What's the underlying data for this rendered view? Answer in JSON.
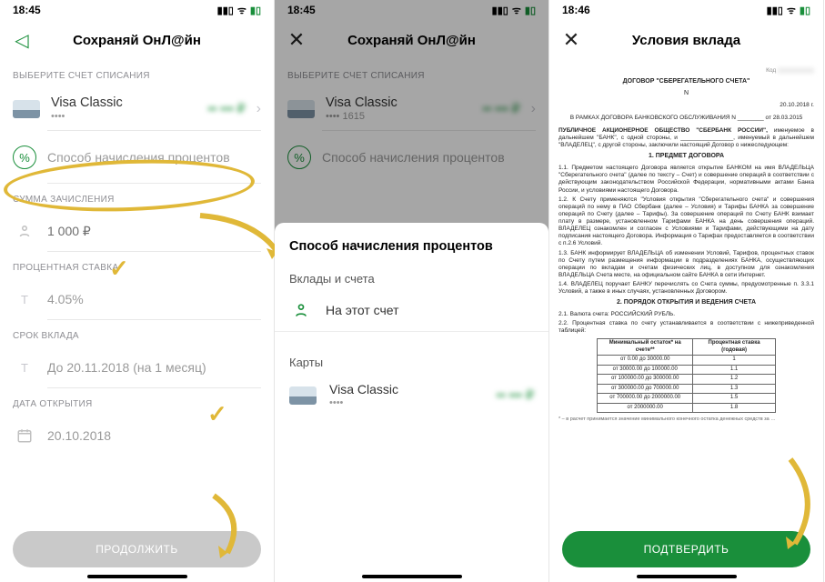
{
  "panel1": {
    "time": "18:45",
    "title": "Сохраняй ОнЛ@йн",
    "accountLabel": "ВЫБЕРИТЕ СЧЕТ СПИСАНИЯ",
    "card": {
      "name": "Visa Classic",
      "mask": "••••",
      "balance": "•• ••• ₽"
    },
    "interestMethod": "Способ начисления процентов",
    "amountLabel": "СУММА ЗАЧИСЛЕНИЯ",
    "amount": "1 000 ₽",
    "rateLabel": "ПРОЦЕНТНАЯ СТАВКА",
    "rate": "4.05%",
    "termLabel": "СРОК ВКЛАДА",
    "term": "До 20.11.2018 (на 1 месяц)",
    "openLabel": "ДАТА ОТКРЫТИЯ",
    "openDate": "20.10.2018",
    "button": "ПРОДОЛЖИТЬ"
  },
  "panel2": {
    "time": "18:45",
    "title": "Сохраняй ОнЛ@йн",
    "accountLabel": "ВЫБЕРИТЕ СЧЕТ СПИСАНИЯ",
    "card": {
      "name": "Visa Classic",
      "mask": "•••• 1615",
      "balance": "•• ••• ₽"
    },
    "interestMethod": "Способ начисления процентов",
    "sheetTitle": "Способ начисления процентов",
    "group1": "Вклады и счета",
    "opt1": "На этот счет",
    "group2": "Карты",
    "optCard": {
      "name": "Visa Classic",
      "mask": "••••",
      "balance": "•• ••• ₽"
    }
  },
  "panel3": {
    "time": "18:46",
    "title": "Условия вклада",
    "button": "ПОДТВЕРДИТЬ",
    "doc": {
      "kod": "Код",
      "head": "ДОГОВОР \"СБЕРЕГАТЕЛЬНОГО СЧЕТА\"",
      "n": "N",
      "date": "20.10.2018 г.",
      "frame": "В РАМКАХ ДОГОВОРА БАНКОВСКОГО ОБСЛУЖИВАНИЯ N ________ от 28.03.2015",
      "intro1": "ПУБЛИЧНОЕ АКЦИОНЕРНОЕ ОБЩЕСТВО \"СБЕРБАНК РОССИИ\",",
      "intro2": "именуемое в дальнейшем \"БАНК\", с одной стороны, и ________________, именуемый в дальнейшем \"ВЛАДЕЛЕЦ\", с другой стороны, заключили настоящий Договор о нижеследующем:",
      "s1": "1. ПРЕДМЕТ ДОГОВОРА",
      "p11": "1.1. Предметом настоящего Договора является открытие БАНКОМ на имя ВЛАДЕЛЬЦА \"Сберегательного счета\" (далее по тексту – Счет) и совершение операций в соответствии с действующим законодательством Российской Федерации, нормативными актами Банка России, и условиями настоящего Договора.",
      "p12": "1.2. К Счету применяются \"Условия открытия \"Сберегательного счета\" и совершения операций по нему в ПАО Сбербанк (далее – Условия) и Тарифы БАНКА за совершение операций по Счету (далее – Тарифы). За совершение операций по Счету БАНК взимает плату в размере, установленном Тарифами БАНКА на день совершения операций. ВЛАДЕЛЕЦ ознакомлен и согласен с Условиями и Тарифами, действующими на дату подписания настоящего Договора. Информация о Тарифах предоставляется в соответствии с п.2.6 Условий.",
      "p13": "1.3. БАНК информирует ВЛАДЕЛЬЦА об изменении Условий, Тарифов, процентных ставок по Счету путем размещения информации в подразделениях БАНКА, осуществляющих операции по вкладам и счетам физических лиц, в доступном для ознакомления ВЛАДЕЛЬЦА Счета месте, на официальном сайте БАНКА в сети Интернет.",
      "p14": "1.4. ВЛАДЕЛЕЦ поручает БАНКУ перечислять со Счета суммы, предусмотренные п. 3.3.1 Условий, а также в иных случаях, установленных Договором.",
      "s2": "2. ПОРЯДОК ОТКРЫТИЯ И ВЕДЕНИЯ СЧЕТА",
      "p21": "2.1. Валюта счета: РОССИЙСКИЙ РУБЛЬ.",
      "p22": "2.2. Процентная ставка по счету устанавливается в соответствии с нижеприведенной таблицей:",
      "tableHead": [
        "Минимальный остаток* на счете**",
        "Процентная ставка (годовая)"
      ],
      "tableRows": [
        [
          "от 0.00 до 30000.00",
          "1"
        ],
        [
          "от 30000.00 до 100000.00",
          "1.1"
        ],
        [
          "от 100000.00 до 300000.00",
          "1.2"
        ],
        [
          "от 300000.00 до 700000.00",
          "1.3"
        ],
        [
          "от 700000.00 до 2000000.00",
          "1.5"
        ],
        [
          "от 2000000.00",
          "1.8"
        ]
      ],
      "foot": "* – в расчет принимается значение минимального конечного остатка денежных средств за …"
    }
  }
}
